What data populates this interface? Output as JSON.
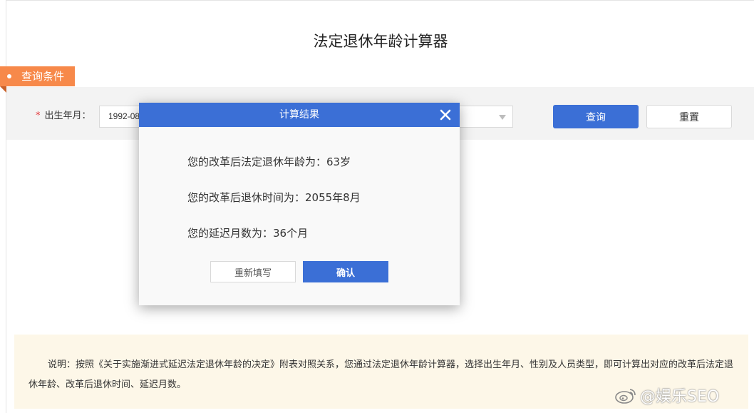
{
  "page": {
    "title": "法定退休年龄计算器"
  },
  "section": {
    "label": "查询条件"
  },
  "form": {
    "birth_label": "出生年月：",
    "required_mark": "*",
    "birth_value": "1992-08",
    "query_button": "查询",
    "reset_button": "重置"
  },
  "dialog": {
    "title": "计算结果",
    "retire_age_line": "您的改革后法定退休年龄为：63岁",
    "retire_time_line": "您的改革后退休时间为：2055年8月",
    "delay_months_line": "您的延迟月数为：36个月",
    "refill_button": "重新填写",
    "confirm_button": "确认"
  },
  "note": {
    "text": "说明：按照《关于实施渐进式延迟法定退休年龄的决定》附表对照关系，您通过法定退休年龄计算器，选择出生年月、性别及人员类型，即可计算出对应的改革后法定退休年龄、改革后退休时间、延迟月数。"
  },
  "watermark": {
    "text": "@娱乐SEO"
  },
  "colors": {
    "primary": "#3b6fd6",
    "tag": "#f7894a",
    "note_bg": "#fdf7e8",
    "required": "#e4393c"
  },
  "icons": {
    "close": "close-icon",
    "select_caret": "chevron-down-icon",
    "weibo": "weibo-icon"
  }
}
